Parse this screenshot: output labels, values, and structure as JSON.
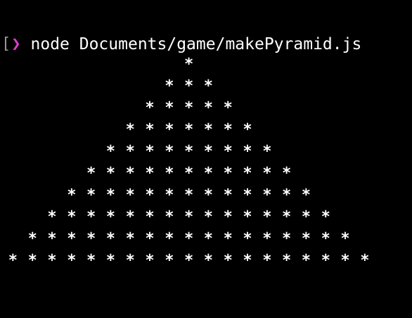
{
  "terminal": {
    "prompt_bracket": "[",
    "prompt_arrow": "❯",
    "command": "node Documents/game/makePyramid.js"
  },
  "pyramid": {
    "glyph": "*",
    "rows": [
      1,
      3,
      5,
      7,
      9,
      11,
      13,
      15,
      17,
      19
    ]
  },
  "colors": {
    "background": "#000000",
    "text": "#ffffff",
    "prompt_accent": "#e23bd0"
  }
}
